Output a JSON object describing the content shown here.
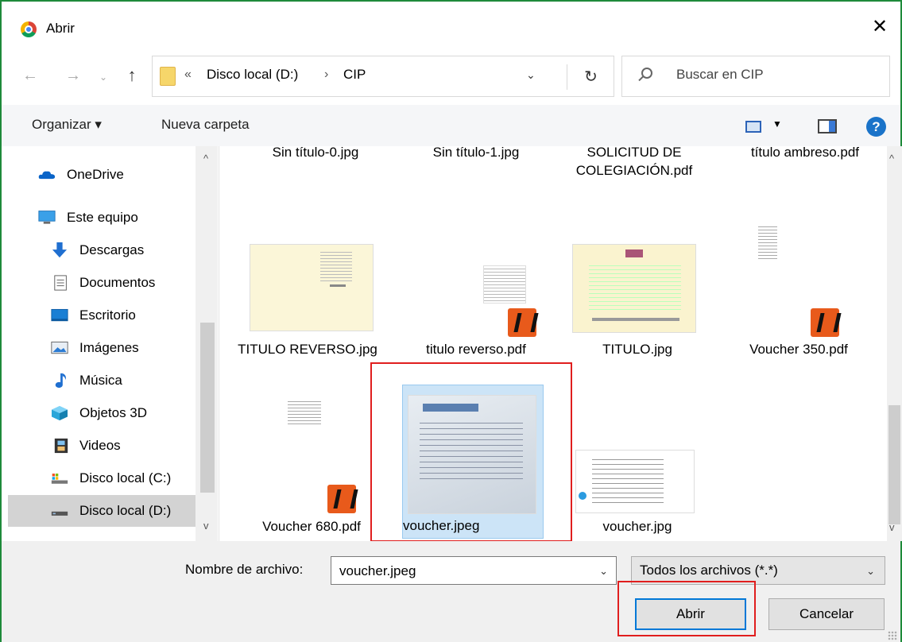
{
  "window": {
    "title": "Abrir",
    "close_glyph": "✕"
  },
  "nav": {
    "back_glyph": "←",
    "forward_glyph": "→",
    "recent_glyph": "⌄",
    "up_glyph": "↑",
    "breadcrumb_overflow": "«",
    "breadcrumb": [
      "Disco local (D:)",
      "CIP"
    ],
    "breadcrumb_sep": "›",
    "dropdown_glyph": "⌄",
    "refresh_glyph": "↻",
    "search_placeholder": "Buscar en CIP"
  },
  "toolbar": {
    "organize_label": "Organizar ▾",
    "new_folder_label": "Nueva carpeta",
    "view_caret": "▼",
    "help_glyph": "?"
  },
  "sidebar": {
    "items": [
      {
        "label": "OneDrive",
        "icon": "onedrive-icon"
      },
      {
        "label": "Este equipo",
        "icon": "computer-icon"
      },
      {
        "label": "Descargas",
        "icon": "downloads-icon"
      },
      {
        "label": "Documentos",
        "icon": "documents-icon"
      },
      {
        "label": "Escritorio",
        "icon": "desktop-icon"
      },
      {
        "label": "Imágenes",
        "icon": "pictures-icon"
      },
      {
        "label": "Música",
        "icon": "music-icon"
      },
      {
        "label": "Objetos 3D",
        "icon": "3d-objects-icon"
      },
      {
        "label": "Videos",
        "icon": "videos-icon"
      },
      {
        "label": "Disco local (C:)",
        "icon": "drive-c-icon"
      },
      {
        "label": "Disco local (D:)",
        "icon": "drive-d-icon"
      }
    ],
    "selected": "Disco local (D:)",
    "scroll_up": "^",
    "scroll_down": "v"
  },
  "files": {
    "row1": [
      "Sin título-0.jpg",
      "Sin título-1.jpg",
      "SOLICITUD DE COLEGIACIÓN.pdf",
      "título ambreso.pdf"
    ],
    "row2": [
      "TITULO REVERSO.jpg",
      "titulo reverso.pdf",
      "TITULO.jpg",
      "Voucher 350.pdf"
    ],
    "row3": [
      "Voucher 680.pdf",
      "voucher.jpeg",
      "voucher.jpg"
    ],
    "selected": "voucher.jpeg"
  },
  "bottom": {
    "filename_label": "Nombre de archivo:",
    "filename_value": "voucher.jpeg",
    "filter_value": "Todos los archivos (*.*)",
    "open_label": "Abrir",
    "cancel_label": "Cancelar",
    "dropdown_glyph": "⌄"
  },
  "colors": {
    "window_border": "#1e8a3a",
    "selection_fill": "#cce4f7",
    "highlight_box": "#e01e1e",
    "primary_button_border": "#0078d7"
  }
}
